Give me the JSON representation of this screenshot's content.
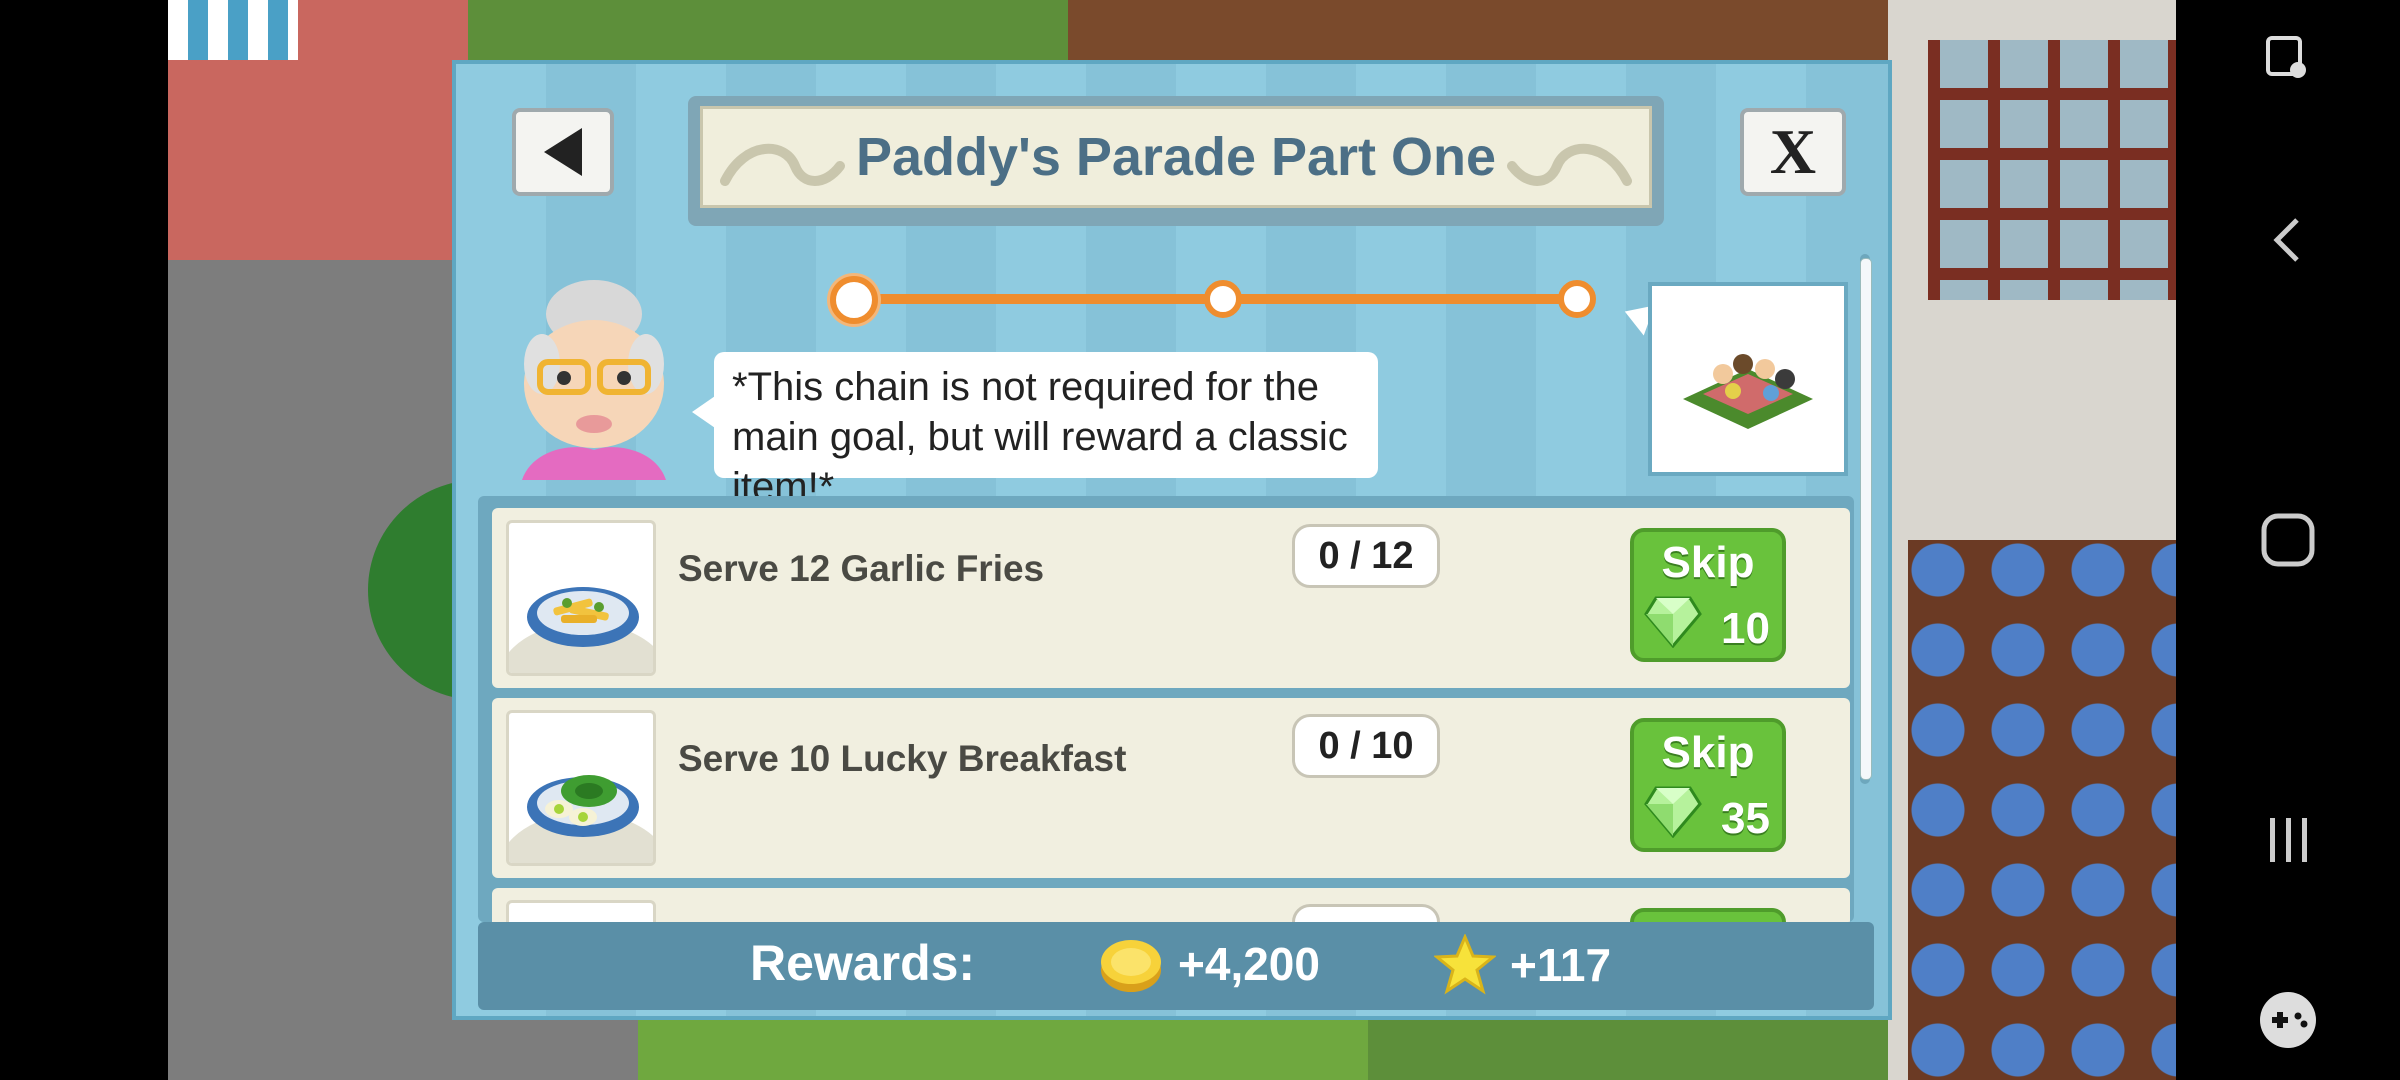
{
  "dialog": {
    "title": "Paddy's Parade Part One",
    "back_icon": "triangle-left-icon",
    "close_label": "X",
    "message": "*This chain is not required for the main goal, but will reward a classic item!*",
    "progress": {
      "current_step": 1,
      "total_steps": 3
    }
  },
  "tasks": [
    {
      "label": "Serve 12 Garlic Fries",
      "count": "0 / 12",
      "skip_label": "Skip",
      "skip_cost": "10"
    },
    {
      "label": "Serve 10 Lucky Breakfast",
      "count": "0 / 10",
      "skip_label": "Skip",
      "skip_cost": "35"
    }
  ],
  "rewards": {
    "label": "Rewards:",
    "coins": "+4,200",
    "stars": "+117"
  },
  "colors": {
    "accent_orange": "#ef8d2e",
    "skip_green": "#69c23c",
    "title_blue": "#4c6f86",
    "panel_blue": "#8fcbe0"
  }
}
